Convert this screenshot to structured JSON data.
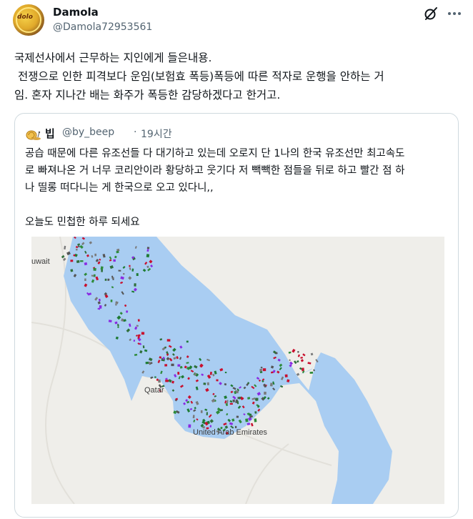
{
  "post": {
    "author": {
      "display_name": "Damola",
      "handle": "@Damola72953561"
    },
    "avatar_text": "dolo",
    "text": "국제선사에서 근무하는 지인에게 들은내용.\n 전쟁으로 인한 피격보다 운임(보험효 폭등)폭등에 따른 적자로 운행을 안하는 거\n임. 혼자 지나간 배는 화주가 폭등한 감당하겠다고 한거고.",
    "icons": {
      "grok": "grok-slash-icon",
      "more": "more-horizontal-icon"
    }
  },
  "quote": {
    "author": {
      "display_name": "빕",
      "handle": "@by_beep",
      "separator": "·",
      "time": "19시간"
    },
    "avatar_icon": "snail-avatar-icon",
    "text": "공습 때문에 다른 유조선들 다 대기하고 있는데 오로지 단 1나의 한국 유조선만 최고속도\n로 빠져나온 거 너무 코리안이라 황당하고 웃기다 저 빽빽한 점들을 뒤로 하고 빨간 점 하\n나 띨롱 떠다니는 게 한국으로 오고 있다니,,\n\n오늘도 민첩한 하루 되세요",
    "map": {
      "labels": {
        "kuwait": "uwait",
        "qatar": "Qatar",
        "uae": "United Arab Emirates"
      },
      "colors": {
        "land": "#efeeea",
        "water": "#a9cdf2",
        "red": "#c8102e",
        "green": "#2e8b3a"
      }
    }
  }
}
